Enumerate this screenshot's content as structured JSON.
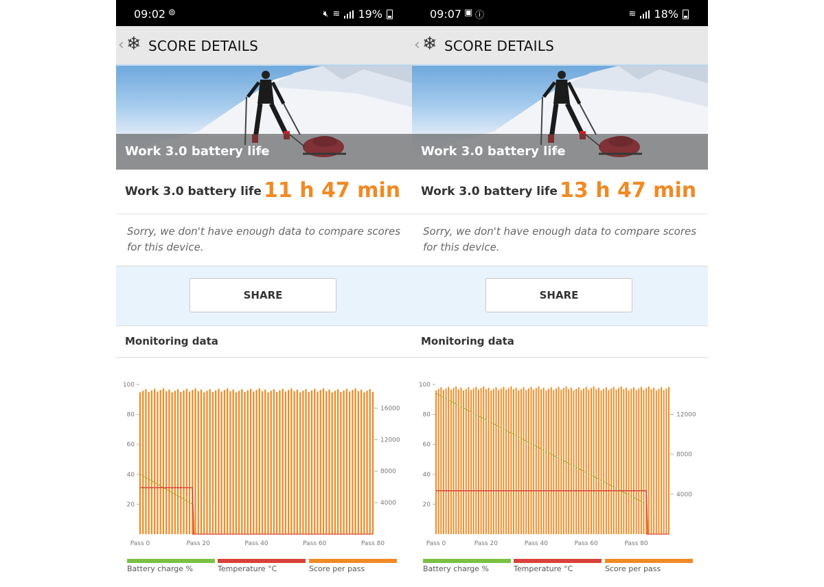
{
  "colors": {
    "accent": "#f08a24",
    "battery": "#7ac142",
    "temperature": "#d9413b",
    "score": "#f08a24"
  },
  "left": {
    "status": {
      "time": "09:02",
      "battery": "19%",
      "icons": [
        "mute-icon",
        "wifi-icon",
        "signal-icon",
        "battery-icon"
      ]
    },
    "header": {
      "title": "SCORE DETAILS"
    },
    "hero": {
      "title": "Work 3.0 battery life",
      "version": "3.0"
    },
    "score": {
      "label": "Work 3.0 battery life",
      "value": "11 h 47 min"
    },
    "note": "Sorry, we don't have enough data to compare scores for this device.",
    "share_label": "SHARE",
    "monitoring_title": "Monitoring data",
    "legend": [
      "Battery charge %",
      "Temperature °C",
      "Score per pass"
    ],
    "chart_data": {
      "type": "bar",
      "x_ticks": [
        "Pass 0",
        "Pass 20",
        "Pass 40",
        "Pass 60",
        "Pass 80"
      ],
      "y_left_ticks": [
        "100",
        "80",
        "60",
        "40",
        "20"
      ],
      "y_right_ticks": [
        "16000",
        "12000",
        "8000",
        "4000"
      ],
      "ylim_left": [
        0,
        100
      ],
      "ylim_right": [
        0,
        19000
      ],
      "passes": 81,
      "series": [
        {
          "name": "Score per pass",
          "axis": "right",
          "values_approx": "~18000-18500 per pass across all 81 passes"
        },
        {
          "name": "Battery charge %",
          "axis": "left",
          "start": 40,
          "end": 20,
          "end_pass": 18
        },
        {
          "name": "Temperature °C",
          "axis": "left",
          "value": 31,
          "end_pass": 18
        }
      ]
    }
  },
  "right": {
    "status": {
      "time": "09:07",
      "battery": "18%",
      "icons": [
        "image-icon",
        "info-icon",
        "wifi-icon",
        "signal-icon",
        "battery-icon"
      ]
    },
    "header": {
      "title": "SCORE DETAILS"
    },
    "hero": {
      "title": "Work 3.0 battery life",
      "version": "3.0"
    },
    "score": {
      "label": "Work 3.0 battery life",
      "value": "13 h 47 min"
    },
    "note": "Sorry, we don't have enough data to compare scores for this device.",
    "share_label": "SHARE",
    "monitoring_title": "Monitoring data",
    "legend": [
      "Battery charge %",
      "Temperature °C",
      "Score per pass"
    ],
    "chart_data": {
      "type": "bar",
      "x_ticks": [
        "Pass 0",
        "Pass 20",
        "Pass 40",
        "Pass 60",
        "Pass 80"
      ],
      "y_left_ticks": [
        "100",
        "80",
        "60",
        "40",
        "20"
      ],
      "y_right_ticks": [
        "12000",
        "8000",
        "4000"
      ],
      "ylim_left": [
        0,
        100
      ],
      "ylim_right": [
        0,
        15000
      ],
      "passes": 94,
      "series": [
        {
          "name": "Score per pass",
          "axis": "right",
          "values_approx": "~14400-14800 per pass across all 94 passes"
        },
        {
          "name": "Battery charge %",
          "axis": "left",
          "start": 94,
          "end": 20,
          "end_pass": 84
        },
        {
          "name": "Temperature °C",
          "axis": "left",
          "value": 29,
          "end_pass": 84
        }
      ]
    }
  }
}
